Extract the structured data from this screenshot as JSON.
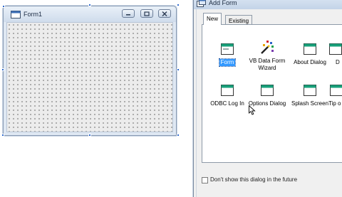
{
  "designer": {
    "form_title": "Form1"
  },
  "dialog": {
    "title": "Add Form",
    "tabs": [
      {
        "label": "New",
        "active": true
      },
      {
        "label": "Existing",
        "active": false
      }
    ],
    "templates": [
      {
        "label": "Form",
        "icon": "form-icon",
        "selected": true
      },
      {
        "label": "VB Data Form",
        "label2": "Wizard",
        "icon": "wizard-icon",
        "selected": false
      },
      {
        "label": "About Dialog",
        "icon": "form-icon",
        "selected": false
      },
      {
        "label": "D",
        "icon": "form-icon",
        "selected": false
      },
      {
        "label": "ODBC Log In",
        "icon": "form-icon",
        "selected": false
      },
      {
        "label": "Options Dialog",
        "icon": "form-icon",
        "selected": false
      },
      {
        "label": "Splash Screen",
        "icon": "form-icon",
        "selected": false
      },
      {
        "label": "Tip o",
        "icon": "form-icon",
        "selected": false
      }
    ],
    "dont_show_label": "Don't show this dialog in the future",
    "dont_show_checked": false
  },
  "colors": {
    "accent_selection": "#3399ff",
    "handle": "#2f6ad0"
  }
}
